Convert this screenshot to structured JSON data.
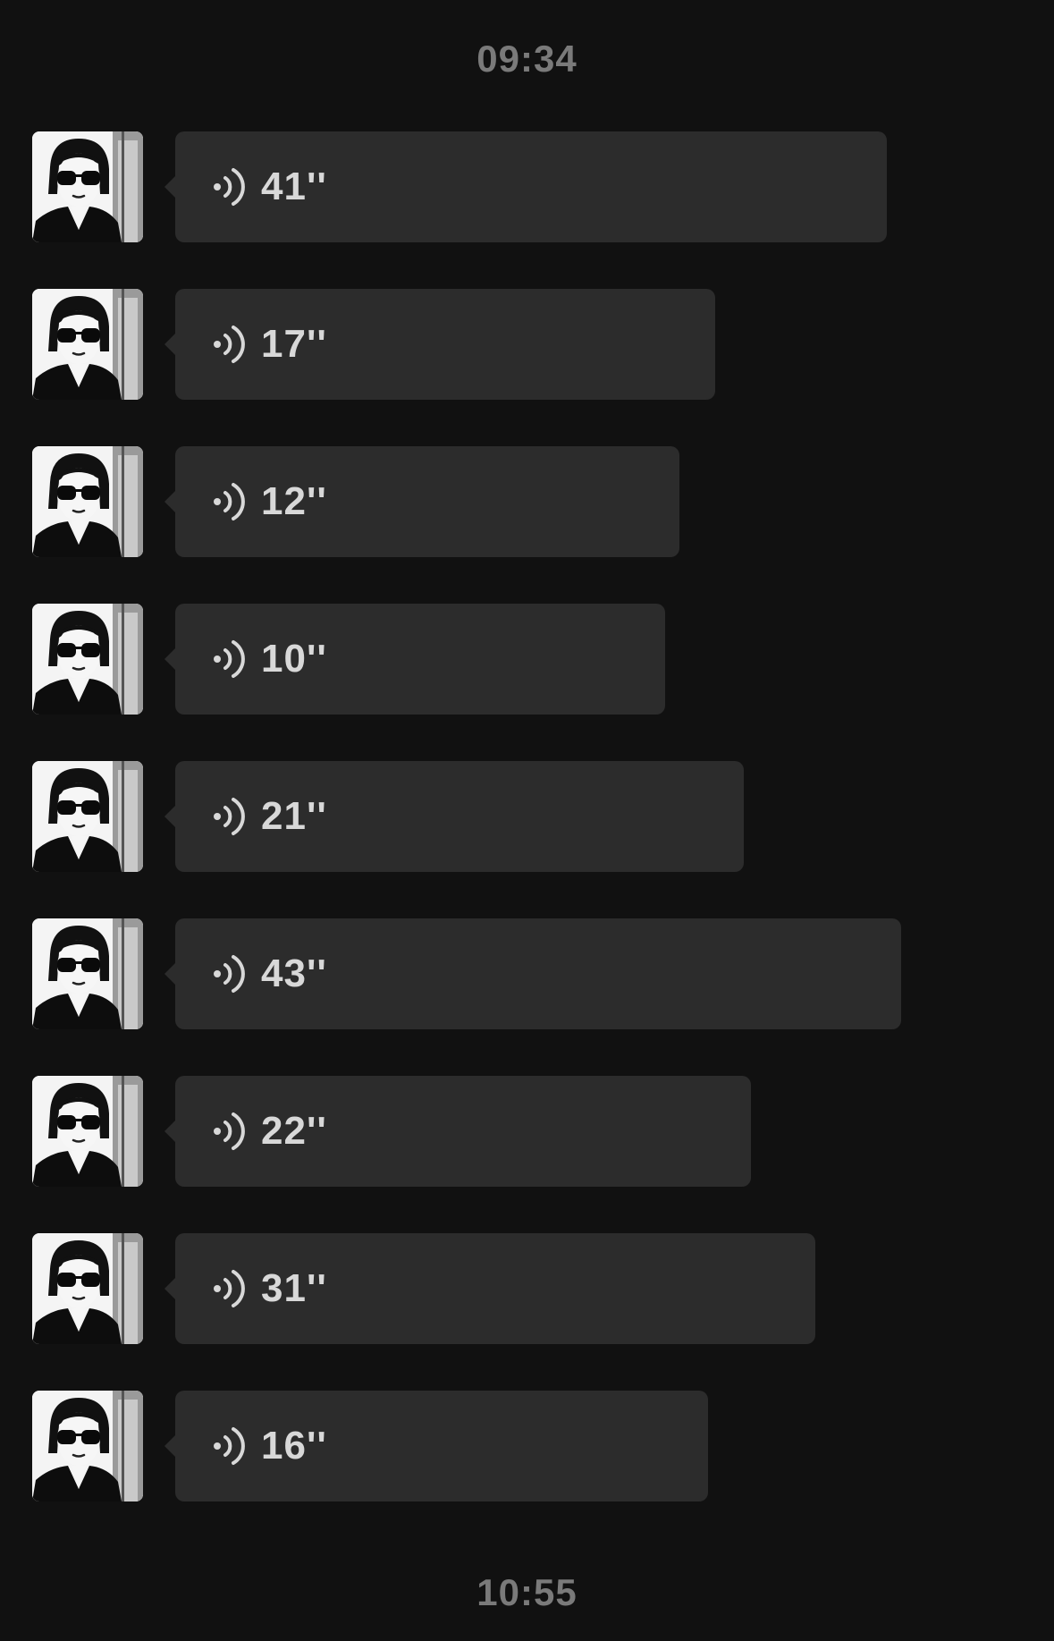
{
  "chat": {
    "timestamp_top": "09:34",
    "timestamp_bottom": "10:55",
    "messages": [
      {
        "duration": "41''",
        "seconds": 41
      },
      {
        "duration": "17''",
        "seconds": 17
      },
      {
        "duration": "12''",
        "seconds": 12
      },
      {
        "duration": "10''",
        "seconds": 10
      },
      {
        "duration": "21''",
        "seconds": 21
      },
      {
        "duration": "43''",
        "seconds": 43
      },
      {
        "duration": "22''",
        "seconds": 22
      },
      {
        "duration": "31''",
        "seconds": 31
      },
      {
        "duration": "16''",
        "seconds": 16
      }
    ]
  },
  "colors": {
    "background": "#111111",
    "bubble": "#2c2c2c",
    "text": "#d8d8d8",
    "timestamp": "#7a7a7a"
  },
  "icons": {
    "voice": "voice-wave-icon",
    "avatar": "avatar-photo"
  }
}
